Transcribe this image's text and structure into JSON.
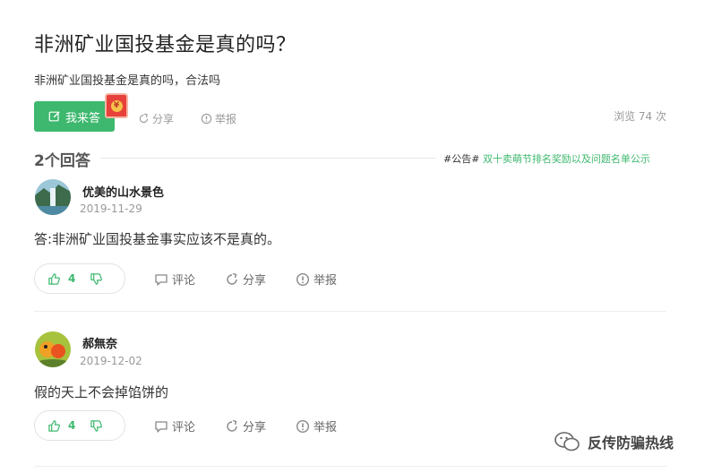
{
  "question": {
    "title": "非洲矿业国投基金是真的吗？",
    "description": "非洲矿业国投基金是真的吗，合法吗",
    "answer_button": "我来答",
    "redpack_coin": "¥",
    "share": "分享",
    "report": "举报",
    "views": "浏览 74 次"
  },
  "answers_header": {
    "count_label": "2个回答",
    "notice_tag": "#公告#",
    "notice_text": "双十卖萌节排名奖励以及问题名单公示"
  },
  "answers": [
    {
      "user": "优美的山水景色",
      "date": "2019-11-29",
      "text": "答:非洲矿业国投基金事实应该不是真的。",
      "likes": "4",
      "comment": "评论",
      "share": "分享",
      "report": "举报"
    },
    {
      "user": "郝無奈",
      "date": "2019-12-02",
      "text": "假的天上不会掉馅饼的",
      "likes": "4",
      "comment": "评论",
      "share": "分享",
      "report": "举报"
    }
  ],
  "watermark": "反传防骗热线",
  "colors": {
    "accent": "#3db86e",
    "muted": "#999999",
    "redpack": "#e8413b"
  }
}
